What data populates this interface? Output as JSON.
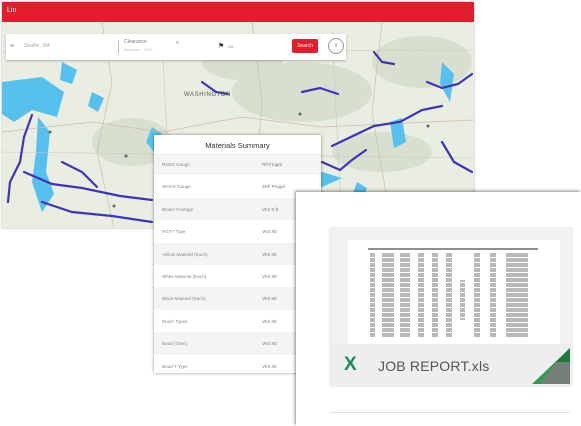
{
  "map_window": {
    "app_title": "Lin",
    "region_label": "WASHINGTON",
    "toolbar": {
      "menu_glyph": "≡",
      "search_value": "Seattle, WA",
      "select_value": "Clearance",
      "select_sub": "Minimum · 13'6\"",
      "flag_label": "US",
      "apply_label": "Search",
      "info_glyph": "i"
    }
  },
  "materials_summary": {
    "title": "Materials Summary",
    "rows": [
      {
        "label": "RNSS Gauge",
        "value": "Rfl Frugal"
      },
      {
        "label": "WHAS Gauge",
        "value": "3SF Frugal"
      },
      {
        "label": "Bloom Footage",
        "value": "Vtnl S ft"
      },
      {
        "label": "PGTY Type",
        "value": "Vtnl Xtl"
      },
      {
        "label": "Yellow Material (Each)",
        "value": "Vtnl Xtl"
      },
      {
        "label": "White Material (Each)",
        "value": "Vtnl Xtl"
      },
      {
        "label": "Black Material (Each)",
        "value": "Vtnl Xtl"
      },
      {
        "label": "Brush Types",
        "value": "Vtnl Xtl"
      },
      {
        "label": "Bead (Gem)",
        "value": "Vtnl Xtl"
      },
      {
        "label": "Bead T Type",
        "value": "Vtnl Xtl"
      }
    ]
  },
  "file_card": {
    "file_name": "JOB REPORT.xls",
    "icon": "excel-x-icon",
    "icon_glyph": "X"
  },
  "colors": {
    "accent_red": "#e11d2e",
    "water_blue": "#4fc3f7",
    "road_purple": "#3d35b8",
    "excel_green": "#1f8b4c"
  }
}
